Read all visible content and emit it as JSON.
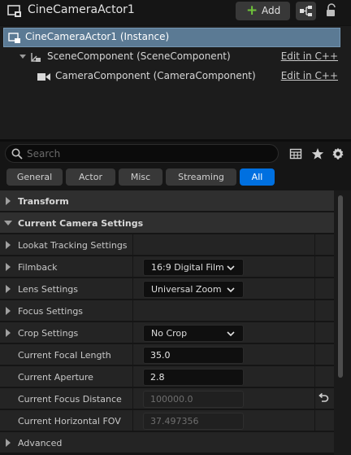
{
  "header": {
    "title": "CineCameraActor1",
    "add_label": "Add",
    "icons": {
      "actor": "actor-icon",
      "add": "plus-icon",
      "blueprint": "blueprint-icon",
      "lock": "lock-icon"
    }
  },
  "tree": {
    "instance_label": "CineCameraActor1 (Instance)",
    "items": [
      {
        "label": "SceneComponent (SceneComponent)",
        "link": "Edit in C++",
        "icon": "scene-component-icon"
      },
      {
        "label": "CameraComponent (CameraComponent)",
        "link": "Edit in C++",
        "icon": "camera-icon"
      }
    ]
  },
  "search": {
    "placeholder": "Search"
  },
  "tabs": [
    {
      "label": "General",
      "active": false
    },
    {
      "label": "Actor",
      "active": false
    },
    {
      "label": "Misc",
      "active": false
    },
    {
      "label": "Streaming",
      "active": false
    },
    {
      "label": "All",
      "active": true
    }
  ],
  "categories": {
    "transform": "Transform",
    "camera_settings": "Current Camera Settings",
    "advanced": "Advanced"
  },
  "properties": {
    "lookat": "Lookat Tracking Settings",
    "filmback": {
      "label": "Filmback",
      "value": "16:9 Digital Film"
    },
    "lens": {
      "label": "Lens Settings",
      "value": "Universal Zoom"
    },
    "focus": "Focus Settings",
    "crop": {
      "label": "Crop Settings",
      "value": "No Crop"
    },
    "focal_length": {
      "label": "Current Focal Length",
      "value": "35.0"
    },
    "aperture": {
      "label": "Current Aperture",
      "value": "2.8"
    },
    "focus_distance": {
      "label": "Current Focus Distance",
      "value": "100000.0"
    },
    "hfov": {
      "label": "Current Horizontal FOV",
      "value": "37.497356"
    }
  },
  "colors": {
    "accent": "#0070e0",
    "selection": "#5b7a94",
    "add_plus": "#6fc33a"
  }
}
